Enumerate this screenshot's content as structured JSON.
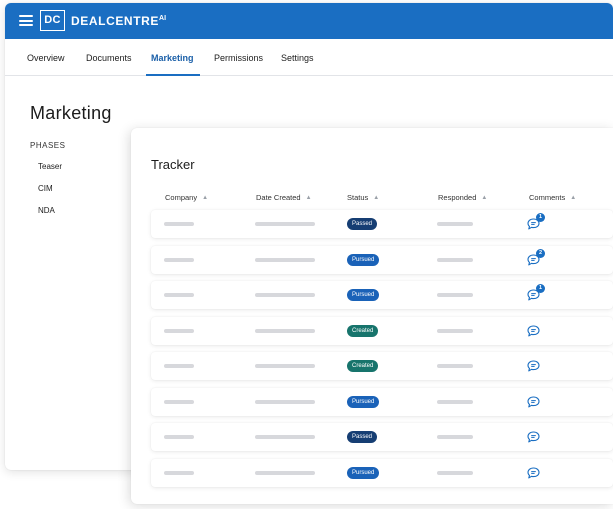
{
  "app": {
    "logo_mark": "DC",
    "logo_name": "DEALCENTRE",
    "logo_suffix": "AI",
    "accent_color": "#1a6ec2"
  },
  "nav": {
    "tabs": [
      {
        "label": "Overview",
        "active": false
      },
      {
        "label": "Documents",
        "active": false
      },
      {
        "label": "Marketing",
        "active": true
      },
      {
        "label": "Permissions",
        "active": false
      },
      {
        "label": "Settings",
        "active": false
      }
    ]
  },
  "page": {
    "title": "Marketing",
    "phases_heading": "PHASES",
    "phases": [
      "Teaser",
      "CIM",
      "NDA"
    ]
  },
  "tracker": {
    "title": "Tracker",
    "columns": [
      "Company",
      "Date Created",
      "Status",
      "Responded",
      "Comments"
    ],
    "rows": [
      {
        "status": "Passed",
        "status_type": "passed",
        "comment_count": "1"
      },
      {
        "status": "Pursued",
        "status_type": "pursued",
        "comment_count": "2"
      },
      {
        "status": "Pursued",
        "status_type": "pursued",
        "comment_count": "1"
      },
      {
        "status": "Created",
        "status_type": "created",
        "comment_count": ""
      },
      {
        "status": "Created",
        "status_type": "created",
        "comment_count": ""
      },
      {
        "status": "Pursued",
        "status_type": "pursued",
        "comment_count": ""
      },
      {
        "status": "Passed",
        "status_type": "passed",
        "comment_count": ""
      },
      {
        "status": "Pursued",
        "status_type": "pursued",
        "comment_count": ""
      }
    ],
    "status_colors": {
      "passed": "#163e73",
      "pursued": "#1a62b8",
      "created": "#17746c"
    },
    "icons": {
      "sort": "sort-icon",
      "comment": "comment-icon"
    }
  }
}
